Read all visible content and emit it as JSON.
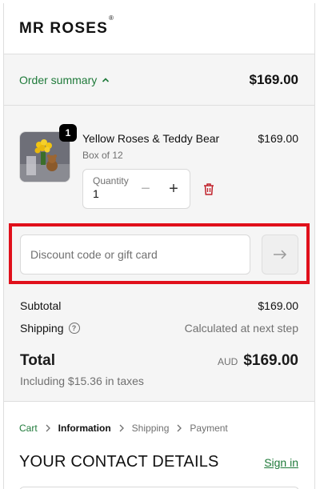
{
  "header": {
    "logo_text": "MR ROSES",
    "logo_mark": "®"
  },
  "summary": {
    "toggle_label": "Order summary",
    "total": "$169.00"
  },
  "item": {
    "quantity_badge": "1",
    "name": "Yellow Roses & Teddy Bear",
    "variant": "Box of 12",
    "price": "$169.00",
    "quantity_label": "Quantity",
    "quantity_value": "1"
  },
  "discount": {
    "placeholder": "Discount code or gift card"
  },
  "totals": {
    "subtotal_label": "Subtotal",
    "subtotal_value": "$169.00",
    "shipping_label": "Shipping",
    "shipping_value": "Calculated at next step",
    "total_label": "Total",
    "currency": "AUD",
    "total_value": "$169.00",
    "taxes_note": "Including $15.36 in taxes"
  },
  "breadcrumb": [
    "Cart",
    "Information",
    "Shipping",
    "Payment"
  ],
  "contact": {
    "title": "YOUR CONTACT DETAILS",
    "sign_in": "Sign in"
  },
  "colors": {
    "accent_green": "#1f7a3a",
    "highlight_red": "#e0101b",
    "delete_red": "#c0202a"
  }
}
